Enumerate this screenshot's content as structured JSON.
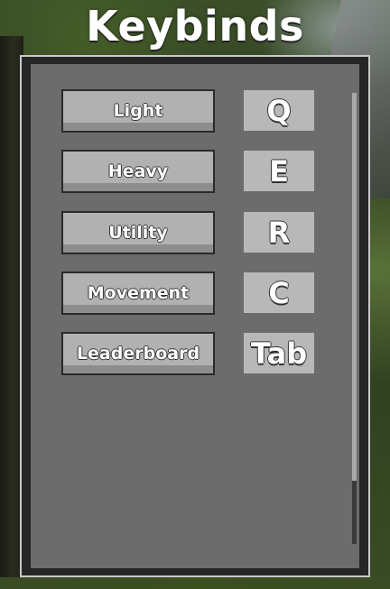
{
  "title": "Keybinds",
  "colors": {
    "panel_bg": "#6c6c6c",
    "panel_border": "#c9c9c9",
    "button_bg": "#b1b1b1",
    "key_bg": "#b8b8b8",
    "text": "#ffffff"
  },
  "keybinds": [
    {
      "action": "Light",
      "key": "Q"
    },
    {
      "action": "Heavy",
      "key": "E"
    },
    {
      "action": "Utility",
      "key": "R"
    },
    {
      "action": "Movement",
      "key": "C"
    },
    {
      "action": "Leaderboard",
      "key": "Tab"
    }
  ]
}
